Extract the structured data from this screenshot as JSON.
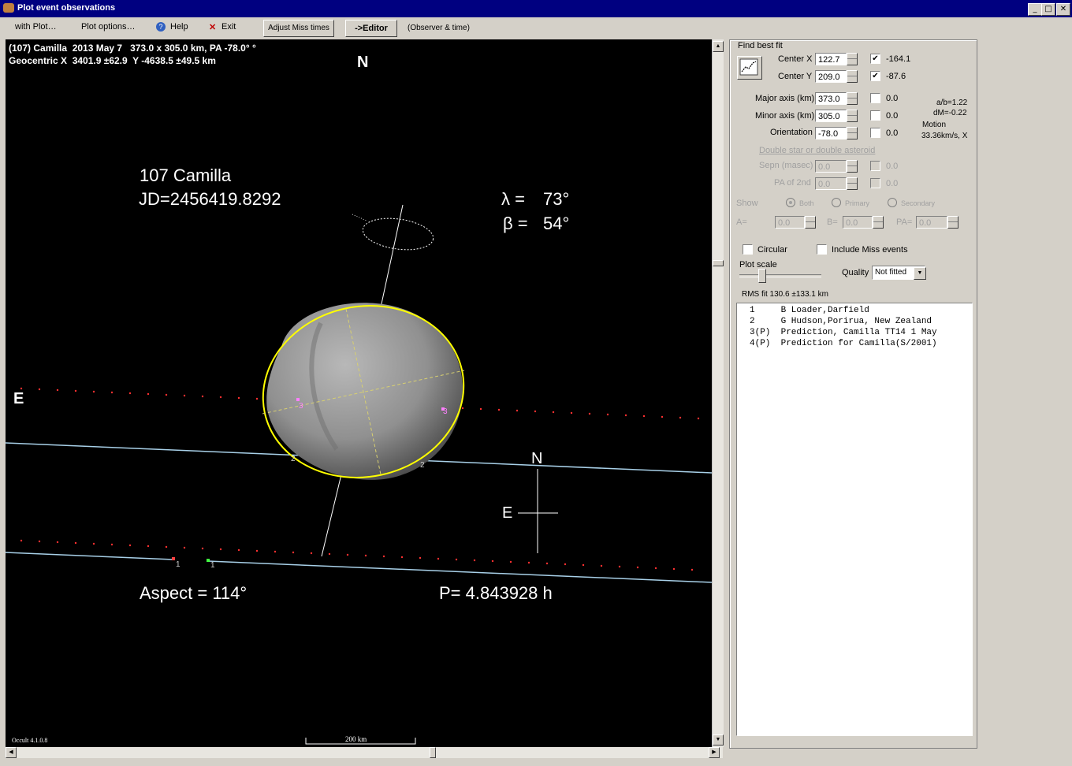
{
  "window": {
    "title": "Plot event observations",
    "controls": [
      "_",
      "□",
      "✕"
    ]
  },
  "menu": {
    "with_plot": "with Plot…",
    "plot_options": "Plot options…",
    "help": "Help",
    "exit": "Exit",
    "adjust_miss": "Adjust Miss times",
    "editor": "->Editor",
    "observer_time": "(Observer & time)"
  },
  "plot": {
    "header_line1": "(107) Camilla  2013 May 7   373.0 x 305.0 km, PA -78.0° °",
    "header_line2": "Geocentric X  3401.9 ±62.9  Y -4638.5 ±49.5 km",
    "north_top": "N",
    "east_left": "E",
    "object_name": "107 Camilla",
    "jd": "JD=2456419.8292",
    "lambda_label": "λ =",
    "lambda_value": "73°",
    "beta_label": "β =",
    "beta_value": "54°",
    "compass_n": "N",
    "compass_e": "E",
    "aspect": "Aspect = 114°",
    "period": "P= 4.843928 h",
    "chord_labels": [
      "3",
      "3",
      "2",
      "2",
      "1",
      "1"
    ],
    "version": "Occult 4.1.0.8",
    "scale_label": "200 km"
  },
  "panel": {
    "find_best_fit": "Find best fit",
    "center_x_label": "Center X",
    "center_x_value": "122.7",
    "center_x_checked": true,
    "center_x_fit": "-164.1",
    "center_y_label": "Center Y",
    "center_y_value": "209.0",
    "center_y_checked": true,
    "center_y_fit": "-87.6",
    "major_label": "Major axis (km)",
    "major_value": "373.0",
    "major_fit": "0.0",
    "minor_label": "Minor axis (km)",
    "minor_value": "305.0",
    "minor_fit": "0.0",
    "orient_label": "Orientation",
    "orient_value": "-78.0",
    "orient_fit": "0.0",
    "ab": "a/b=1.22",
    "dm": "dM=-0.22",
    "motion_label": "Motion",
    "motion_value": "33.36km/s, X",
    "double_label": "Double star  or  double asteroid",
    "sepn_label": "Sepn (masec)",
    "sepn_value": "0.0",
    "sepn_fit": "0.0",
    "pa2_label": "PA of 2nd",
    "pa2_value": "0.0",
    "pa2_fit": "0.0",
    "show_label": "Show",
    "show_both": "Both",
    "show_primary": "Primary",
    "show_secondary": "Secondary",
    "a_label": "A=",
    "a_value": "0.0",
    "b_label": "B=",
    "b_value": "0.0",
    "pa_label": "PA=",
    "pa_value": "0.0",
    "circular": "Circular",
    "include_miss": "Include Miss events",
    "plot_scale": "Plot scale",
    "quality_label": "Quality",
    "quality_value": "Not fitted",
    "rms": "RMS fit 130.6 ±133.1 km",
    "observers": [
      "1     B Loader,Darfield",
      "2     G Hudson,Porirua, New Zealand",
      "3(P)  Prediction, Camilla TT14 1 May",
      "4(P)  Prediction for Camilla(S/2001)"
    ]
  }
}
